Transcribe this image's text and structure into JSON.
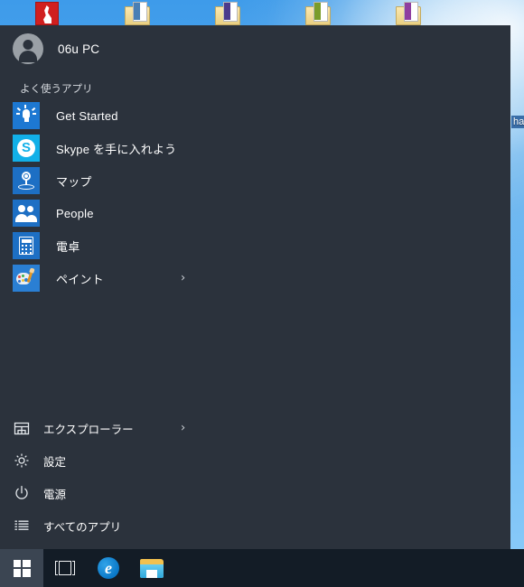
{
  "desktop": {
    "icons": [
      {
        "name": "adobe-reader",
        "caption": "",
        "type": "pdf"
      },
      {
        "name": "document-1",
        "caption": "",
        "type": "doc",
        "band": "#4a7fb5"
      },
      {
        "name": "document-2",
        "caption": "",
        "type": "doc",
        "band": "#4b3a8c"
      },
      {
        "name": "document-3",
        "caption": "",
        "type": "doc",
        "band": "#7a9c2a"
      },
      {
        "name": "document-4",
        "caption": "",
        "type": "doc",
        "band": "#8e3ea0"
      }
    ],
    "edge_label": "har"
  },
  "start_menu": {
    "user": {
      "name": "06u PC",
      "avatar": "user-avatar"
    },
    "section_header": "よく使うアプリ",
    "most_used": [
      {
        "label": "Get Started",
        "icon": "lightbulb-icon",
        "tile": "t-bulb",
        "chevron": ""
      },
      {
        "label": "Skype を手に入れよう",
        "icon": "skype-icon",
        "tile": "t-skype",
        "chevron": ""
      },
      {
        "label": "マップ",
        "icon": "maps-pin-icon",
        "tile": "t-maps",
        "chevron": ""
      },
      {
        "label": "People",
        "icon": "people-icon",
        "tile": "t-people",
        "chevron": ""
      },
      {
        "label": "電卓",
        "icon": "calculator-icon",
        "tile": "t-calc",
        "chevron": ""
      },
      {
        "label": "ペイント",
        "icon": "paint-palette-icon",
        "tile": "t-paint",
        "chevron": "›"
      }
    ],
    "bottom_links": [
      {
        "label": "エクスプローラー",
        "icon": "file-explorer-icon",
        "chevron": "›"
      },
      {
        "label": "設定",
        "icon": "gear-icon",
        "chevron": ""
      },
      {
        "label": "電源",
        "icon": "power-icon",
        "chevron": ""
      },
      {
        "label": "すべてのアプリ",
        "icon": "all-apps-list-icon",
        "chevron": ""
      }
    ]
  },
  "taskbar": {
    "start_button": "start-button",
    "buttons": [
      {
        "name": "task-view-button",
        "icon": "task-view-icon"
      },
      {
        "name": "edge-button",
        "icon": "edge-icon",
        "glyph": "e"
      },
      {
        "name": "file-explorer-button",
        "icon": "file-explorer-icon"
      }
    ]
  },
  "colors": {
    "start_bg": "#2b323c",
    "taskbar_bg": "#131c26",
    "start_button_highlight": "#3b4552",
    "accent_blue": "#1d6fc4",
    "skype_cyan": "#12b0e8",
    "desktop_blue": "#53a9ef"
  }
}
